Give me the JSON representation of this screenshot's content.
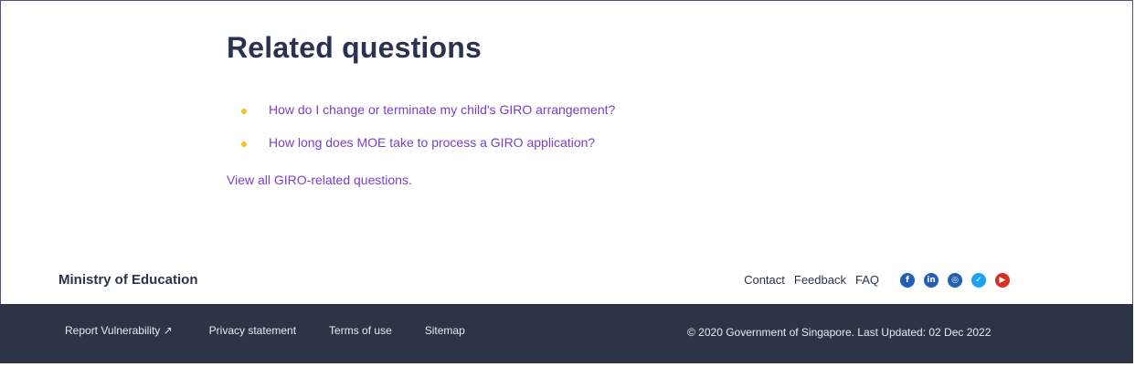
{
  "related": {
    "title": "Related questions",
    "questions": [
      "How do I change or terminate my child's GIRO arrangement?",
      "How long does MOE take to process a GIRO application?"
    ],
    "view_all": "View all GIRO-related questions."
  },
  "footer": {
    "org_name": "Ministry of Education",
    "top_links": [
      "Contact",
      "Feedback",
      "FAQ"
    ],
    "social": [
      {
        "icon": "facebook-icon",
        "glyph": "f",
        "color": "#1f5fb4"
      },
      {
        "icon": "linkedin-icon",
        "glyph": "in",
        "color": "#1f5fb4"
      },
      {
        "icon": "instagram-icon",
        "glyph": "◎",
        "color": "#1f5fb4"
      },
      {
        "icon": "twitter-icon",
        "glyph": "✓",
        "color": "#1da1f2"
      },
      {
        "icon": "youtube-icon",
        "glyph": "▶",
        "color": "#d93025"
      }
    ],
    "bottom_links": [
      "Report Vulnerability ↗",
      "Privacy statement",
      "Terms of use",
      "Sitemap"
    ],
    "copyright": "© 2020 Government of Singapore. Last Updated: 02 Dec 2022"
  },
  "colors": {
    "link": "#7b3fc8",
    "bullet": "#f2c12e",
    "heading": "#2b3250",
    "footer_bg": "#2e3448"
  }
}
